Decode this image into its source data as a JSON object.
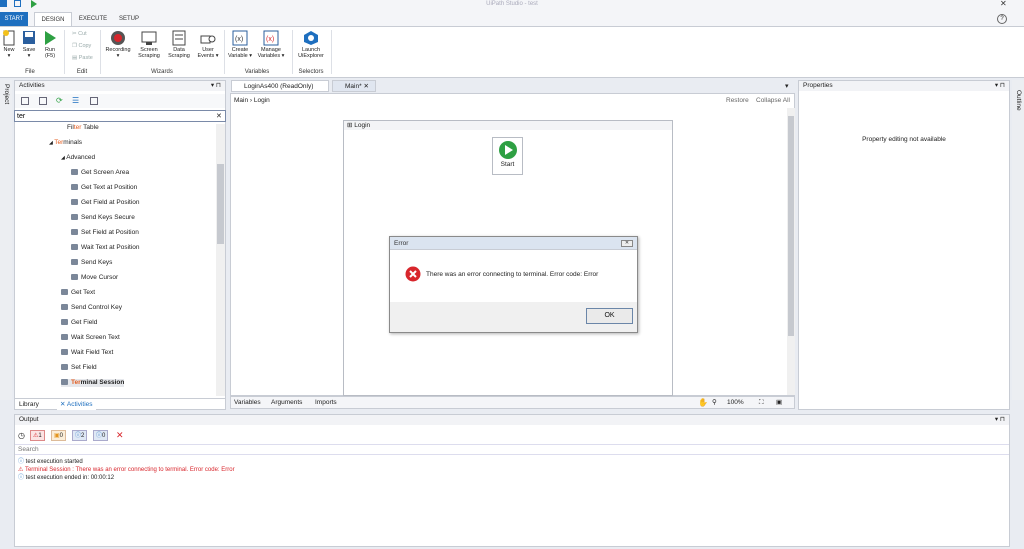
{
  "window": {
    "title": "UiPath Studio - test"
  },
  "ribbon": {
    "tabs": [
      "START",
      "DESIGN",
      "EXECUTE",
      "SETUP"
    ],
    "file": {
      "new": "New",
      "save": "Save",
      "run": "Run",
      "run_key": "(F5)",
      "group": "File"
    },
    "edit": {
      "cut": "Cut",
      "copy": "Copy",
      "paste": "Paste",
      "group": "Edit"
    },
    "wizards": {
      "recording": "Recording",
      "screen": "Screen",
      "screen2": "Scraping",
      "data": "Data",
      "data2": "Scraping",
      "user": "User",
      "user2": "Events",
      "group": "Wizards"
    },
    "variables": {
      "create": "Create",
      "create2": "Variable",
      "manage": "Manage",
      "manage2": "Variables",
      "group": "Variables"
    },
    "selectors": {
      "launch": "Launch",
      "launch2": "UiExplorer",
      "group": "Selectors"
    }
  },
  "side_tabs": {
    "project": "Project",
    "outline": "Outline"
  },
  "activities": {
    "header": "Activities",
    "search_value": "ter",
    "items": [
      {
        "prefix": "Fil",
        "hl": "ter",
        "suffix": " Table",
        "indent": 52,
        "leaf": false,
        "bold": false
      },
      {
        "prefix": "",
        "hl": "Ter",
        "suffix": "minals",
        "indent": 34,
        "leaf": false,
        "bold": false
      },
      {
        "prefix": "",
        "hl": "",
        "suffix": "Advanced",
        "indent": 46,
        "leaf": false,
        "bold": false
      },
      {
        "prefix": "",
        "hl": "",
        "suffix": "Get Screen Area",
        "indent": 56,
        "leaf": true,
        "bold": false
      },
      {
        "prefix": "",
        "hl": "",
        "suffix": "Get Text at Position",
        "indent": 56,
        "leaf": true,
        "bold": false
      },
      {
        "prefix": "",
        "hl": "",
        "suffix": "Get Field at Position",
        "indent": 56,
        "leaf": true,
        "bold": false
      },
      {
        "prefix": "",
        "hl": "",
        "suffix": "Send Keys Secure",
        "indent": 56,
        "leaf": true,
        "bold": false
      },
      {
        "prefix": "",
        "hl": "",
        "suffix": "Set Field at Position",
        "indent": 56,
        "leaf": true,
        "bold": false
      },
      {
        "prefix": "",
        "hl": "",
        "suffix": "Wait Text at Position",
        "indent": 56,
        "leaf": true,
        "bold": false
      },
      {
        "prefix": "",
        "hl": "",
        "suffix": "Send Keys",
        "indent": 56,
        "leaf": true,
        "bold": false
      },
      {
        "prefix": "",
        "hl": "",
        "suffix": "Move Cursor",
        "indent": 56,
        "leaf": true,
        "bold": false
      },
      {
        "prefix": "",
        "hl": "",
        "suffix": "Get Text",
        "indent": 46,
        "leaf": true,
        "bold": false
      },
      {
        "prefix": "",
        "hl": "",
        "suffix": "Send Control Key",
        "indent": 46,
        "leaf": true,
        "bold": false
      },
      {
        "prefix": "",
        "hl": "",
        "suffix": "Get Field",
        "indent": 46,
        "leaf": true,
        "bold": false
      },
      {
        "prefix": "",
        "hl": "",
        "suffix": "Wait Screen Text",
        "indent": 46,
        "leaf": true,
        "bold": false
      },
      {
        "prefix": "",
        "hl": "",
        "suffix": "Wait Field Text",
        "indent": 46,
        "leaf": true,
        "bold": false
      },
      {
        "prefix": "",
        "hl": "",
        "suffix": "Set Field",
        "indent": 46,
        "leaf": true,
        "bold": false
      },
      {
        "prefix": "",
        "hl": "Ter",
        "suffix": "minal Session",
        "indent": 46,
        "leaf": true,
        "bold": true
      }
    ],
    "bottom_tabs": {
      "library": "Library",
      "activities": "Activities"
    }
  },
  "designer": {
    "tabs": {
      "login_as400": "LoginAs400 (ReadOnly)",
      "main": "Main*"
    },
    "breadcrumb": {
      "main": "Main",
      "login": "Login"
    },
    "restore": "Restore",
    "collapse_all": "Collapse All",
    "sequence_title": "Login",
    "start_label": "Start",
    "bottom": {
      "variables": "Variables",
      "arguments": "Arguments",
      "imports": "Imports",
      "zoom": "100%"
    }
  },
  "properties": {
    "header": "Properties",
    "message": "Property editing not available"
  },
  "dialog": {
    "title": "Error",
    "message": "There was an error connecting to terminal. Error code: Error",
    "ok": "OK"
  },
  "output": {
    "header": "Output",
    "badges": {
      "errors": "1",
      "warnings": "0",
      "info": "2",
      "trace": "0"
    },
    "search_placeholder": "Search",
    "lines": [
      {
        "text": "test execution started",
        "kind": "info"
      },
      {
        "text": "Terminal Session : There was an error connecting to terminal. Error code: Error",
        "kind": "error"
      },
      {
        "text": "test execution ended in: 00:00:12",
        "kind": "info"
      }
    ]
  },
  "colors": {
    "accent": "#1e6fbf",
    "highlight": "#e35c1f",
    "error": "#d8262c",
    "run": "#2ea043"
  }
}
